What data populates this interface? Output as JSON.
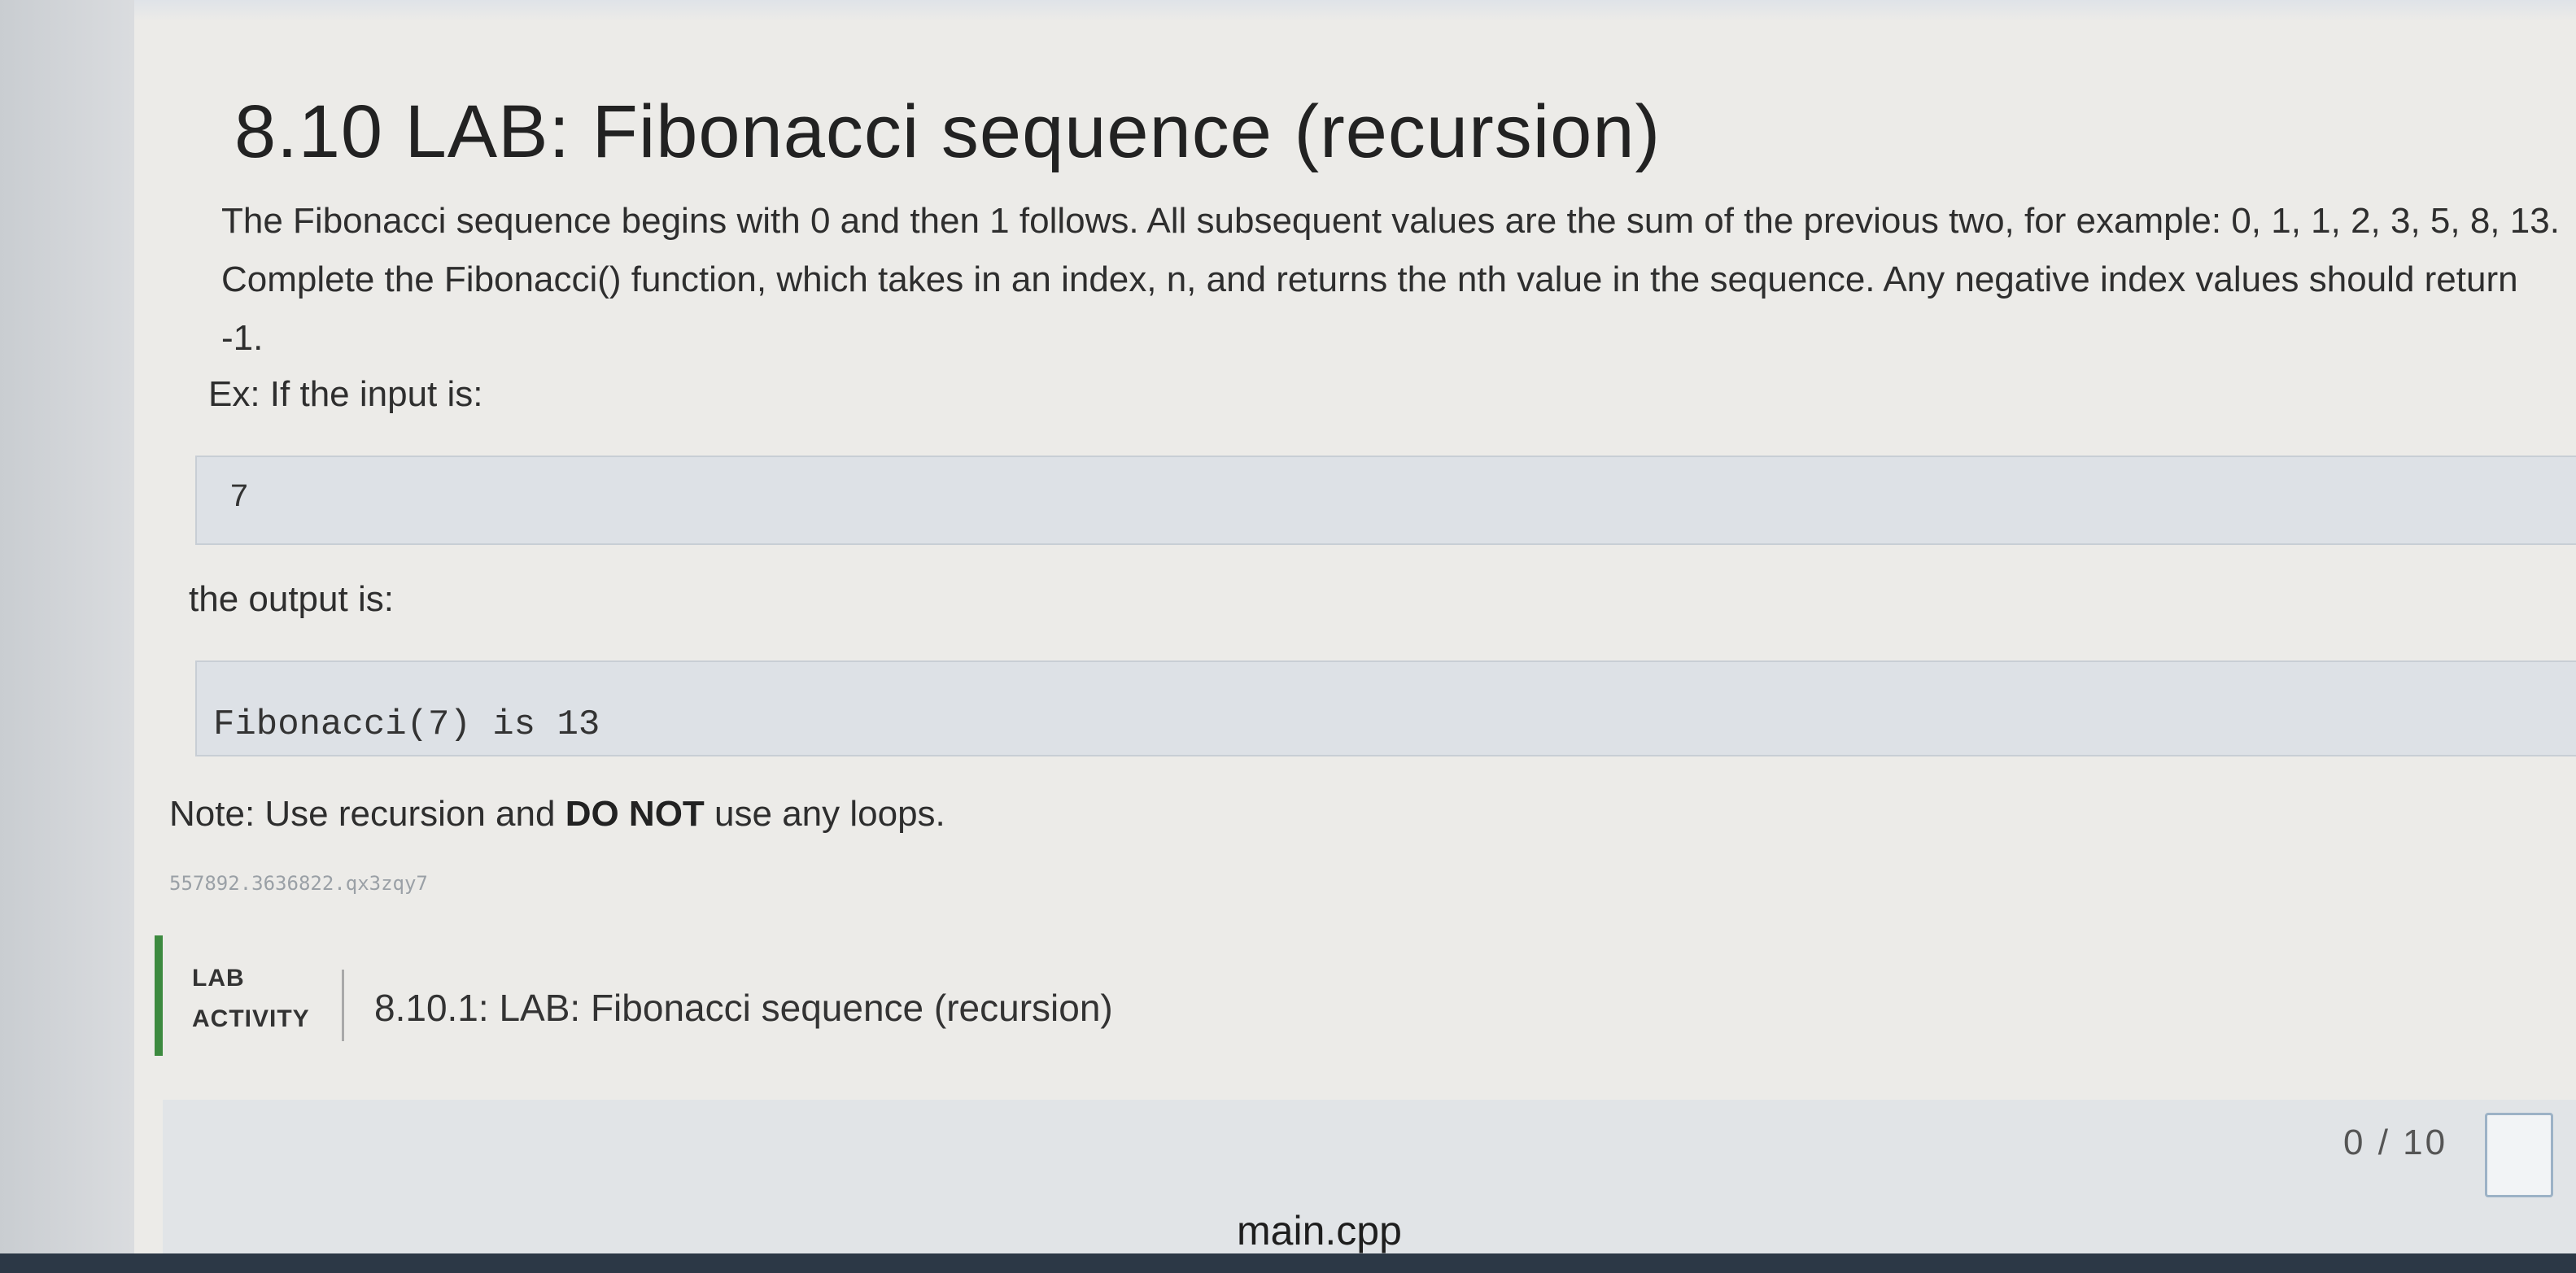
{
  "page": {
    "title": "8.10 LAB: Fibonacci sequence (recursion)"
  },
  "description": {
    "text": "The Fibonacci sequence begins with 0 and then 1 follows. All subsequent values are the sum of the previous two, for example: 0, 1, 1, 2, 3, 5, 8, 13. Complete the Fibonacci() function, which takes in an index, n, and returns the nth value in the sequence. Any negative index values should return -1."
  },
  "example": {
    "input_label": "Ex: If the input is:",
    "input_value": "7",
    "output_label": "the output is:",
    "output_value": "Fibonacci(7) is 13"
  },
  "note": {
    "prefix": "Note: Use recursion and ",
    "emphasis": "DO NOT",
    "suffix": " use any loops."
  },
  "activity_id": "557892.3636822.qx3zqy7",
  "lab_activity": {
    "type_line1": "LAB",
    "type_line2": "ACTIVITY",
    "name": "8.10.1: LAB: Fibonacci sequence (recursion)",
    "score": "0 / 10",
    "filename": "main.cpp"
  },
  "colors": {
    "accent_green": "#3c8a3f",
    "panel_bg": "#dde1e6"
  }
}
